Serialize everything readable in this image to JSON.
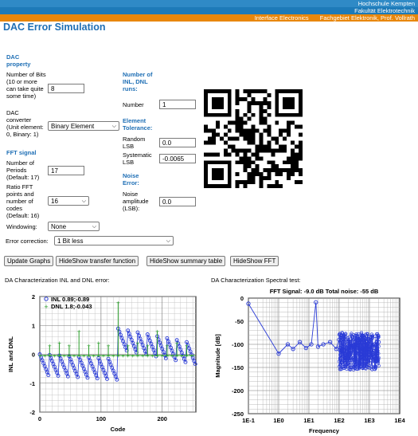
{
  "header": {
    "line1": "Hochschule Kempten",
    "line2": "Fakultät Elektrotechnik",
    "line3a": "Interface Electronics",
    "line3b": "Fachgebiet Elektronik, Prof. Vollrath"
  },
  "title": "DAC Error Simulation",
  "dac": {
    "heading": "DAC property",
    "bits_label": "Number of Bits (10 or more can take quite some time)",
    "bits_value": "8",
    "converter_label": "DAC converter (Unit element: 0, Binary: 1)",
    "converter_value": "Binary Element"
  },
  "fft": {
    "heading": "FFT signal",
    "periods_label": "Number of Periods (Default: 17)",
    "periods_value": "17",
    "ratio_label": "Ratio FFT points and number of codes (Default: 16)",
    "ratio_value": "16",
    "windowing_label": "Windowing:",
    "windowing_value": "None"
  },
  "runs": {
    "heading": "Number of INL, DNL runs:",
    "number_label": "Number",
    "number_value": "1"
  },
  "tolerance": {
    "heading": "Element Tolerance:",
    "random_label": "Random LSB",
    "random_value": "0.0",
    "systematic_label": "Systematic LSB",
    "systematic_value": "-0.0065"
  },
  "noise": {
    "heading": "Noise Error:",
    "amplitude_label": "Noise amplitude (LSB):",
    "amplitude_value": "0.0"
  },
  "error_correction": {
    "label": "Error correction:",
    "value": "1 Bit less"
  },
  "buttons": {
    "update": "Update Graphs",
    "transfer": "HideShow transfer function",
    "summary": "HideShow summary table",
    "fft": "HideShow FFT"
  },
  "chart_data": [
    {
      "type": "scatter",
      "title": "DA Characterization INL and DNL error:",
      "xlabel": "Code",
      "ylabel": "INL and DNL",
      "xlim": [
        0,
        255
      ],
      "ylim": [
        -2,
        2
      ],
      "xticks": [
        "0",
        "100",
        "200"
      ],
      "yticks": [
        "2",
        "1",
        "0",
        "-1",
        "-2"
      ],
      "grid": true,
      "legend_position": "top-left",
      "series": [
        {
          "name": "INL 0.89;-0.89",
          "color": "#2a3bd6",
          "marker": "circle",
          "pattern": "sawtooth",
          "period_codes": 16,
          "amplitude_lsb": 0.89
        },
        {
          "name": "DNL 1.8;-0.043",
          "color": "#2a9d2a",
          "marker": "plus",
          "baseline": -0.043,
          "spikes": [
            [
              16,
              0.3
            ],
            [
              32,
              0.4
            ],
            [
              48,
              0.3
            ],
            [
              64,
              0.8
            ],
            [
              80,
              0.3
            ],
            [
              96,
              0.4
            ],
            [
              112,
              0.3
            ],
            [
              128,
              1.8
            ],
            [
              144,
              0.3
            ],
            [
              160,
              0.4
            ],
            [
              176,
              0.3
            ],
            [
              192,
              0.8
            ],
            [
              208,
              0.3
            ],
            [
              224,
              0.4
            ],
            [
              240,
              0.3
            ]
          ]
        }
      ]
    },
    {
      "type": "line",
      "title": "DA Characterization Spectral test:",
      "subtitle": "FFT Signal: -9.0 dB Total noise: -55 dB",
      "xlabel": "Frequency",
      "ylabel": "Magnitude [dB]",
      "xscale": "log",
      "xlim": [
        0.1,
        10000
      ],
      "ylim": [
        -250,
        0
      ],
      "xticks": [
        "1E-1",
        "1E0",
        "1E1",
        "1E2",
        "1E3",
        "1E4"
      ],
      "yticks": [
        "0",
        "-50",
        "-100",
        "-150",
        "-200",
        "-250"
      ],
      "grid": true,
      "series": [
        {
          "name": "",
          "color": "#2a3bd6",
          "marker": "circle",
          "points": [
            [
              0.1,
              -12
            ],
            [
              1,
              -120
            ],
            [
              2,
              -100
            ],
            [
              3,
              -110
            ],
            [
              5,
              -95
            ],
            [
              8,
              -108
            ],
            [
              12,
              -100
            ],
            [
              17,
              -9
            ],
            [
              20,
              -105
            ],
            [
              30,
              -100
            ],
            [
              50,
              -95
            ],
            [
              80,
              -110
            ],
            [
              100,
              -90
            ],
            [
              150,
              -100
            ],
            [
              200,
              -95
            ],
            [
              300,
              -105
            ],
            [
              500,
              -100
            ],
            [
              800,
              -95
            ],
            [
              1000,
              -110
            ],
            [
              1500,
              -100
            ],
            [
              2000,
              -95
            ]
          ],
          "noise_band_db": [
            -155,
            -75
          ],
          "noise_band_hz": [
            100,
            2048
          ]
        }
      ]
    }
  ]
}
